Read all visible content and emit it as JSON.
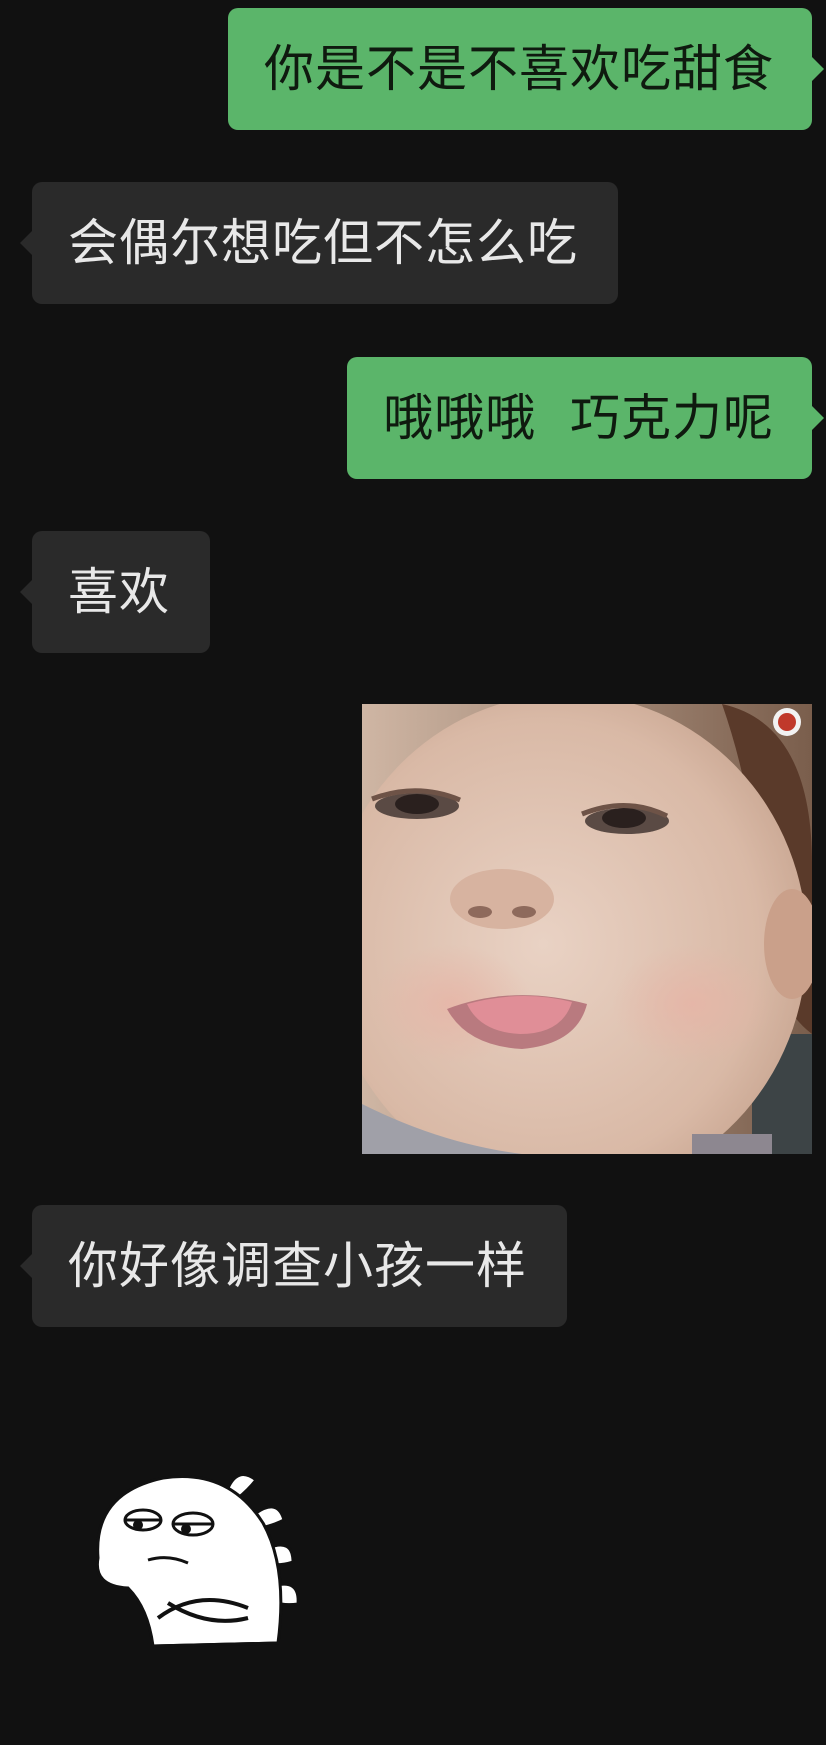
{
  "messages": [
    {
      "side": "out",
      "text": "你是不是不喜欢吃甜食"
    },
    {
      "side": "in",
      "text": "会偶尔想吃但不怎么吃"
    },
    {
      "side": "out",
      "text": "哦哦哦  巧克力呢"
    },
    {
      "side": "in",
      "text": "喜欢"
    },
    {
      "side": "out",
      "type": "image",
      "icon": "child-tongue-photo"
    },
    {
      "side": "in",
      "text": "你好像调查小孩一样"
    },
    {
      "side": "in",
      "type": "sticker",
      "icon": "white-dinosaur-arms-crossed-sticker"
    }
  ],
  "colors": {
    "background": "#111111",
    "outgoing_bubble": "#5bb56a",
    "incoming_bubble": "#2a2a2a"
  }
}
